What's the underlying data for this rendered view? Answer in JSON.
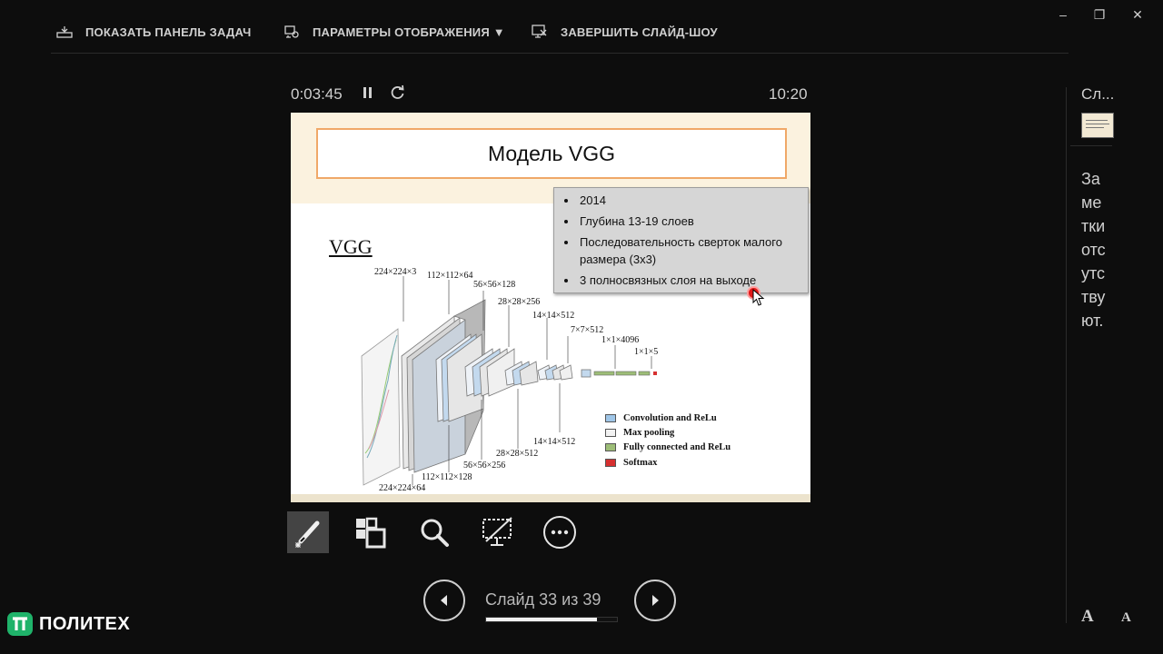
{
  "toolbar_top": {
    "show_taskbar": "ПОКАЗАТЬ ПАНЕЛЬ ЗАДАЧ",
    "display_settings": "ПАРАМЕТРЫ ОТОБРАЖЕНИЯ ▼",
    "end_slideshow": "ЗАВЕРШИТЬ СЛАЙД-ШОУ"
  },
  "window_controls": {
    "minimize": "–",
    "restore": "❐",
    "close": "✕"
  },
  "presenter": {
    "elapsed": "0:03:45",
    "clock": "10:20"
  },
  "slide": {
    "title": "Модель VGG",
    "bullets": [
      "2014",
      "Глубина 13-19 слоев",
      "Последовательность сверток малого размера (3х3)",
      "3 полносвязных слоя на выходе"
    ],
    "figure": {
      "heading": "VGG",
      "top_dims": [
        "224×224×3",
        "112×112×64",
        "56×56×128",
        "28×28×256",
        "14×14×512",
        "7×7×512",
        "1×1×4096",
        "1×1×5"
      ],
      "bottom_dims": [
        "224×224×64",
        "112×112×128",
        "56×56×256",
        "28×28×512",
        "14×14×512"
      ],
      "legend": [
        {
          "label": "Convolution and ReLu",
          "color": "#9fc6e8"
        },
        {
          "label": "Max pooling",
          "color": "#f2f2f2"
        },
        {
          "label": "Fully connected and ReLu",
          "color": "#9dbd77"
        },
        {
          "label": "Softmax",
          "color": "#d63030"
        }
      ]
    }
  },
  "tools": [
    "pen-laser-tool",
    "see-all-slides",
    "zoom",
    "black-screen",
    "more-options"
  ],
  "navigation": {
    "counter": "Слайд 33 из 39",
    "current": 33,
    "total": 39
  },
  "side_panel": {
    "next_label": "Сл...",
    "notes": "Заметки отсутствуют.",
    "font_increase": "A",
    "font_decrease": "A"
  },
  "brand": {
    "name": "ПОЛИТЕХ",
    "color": "#1fb36a"
  }
}
